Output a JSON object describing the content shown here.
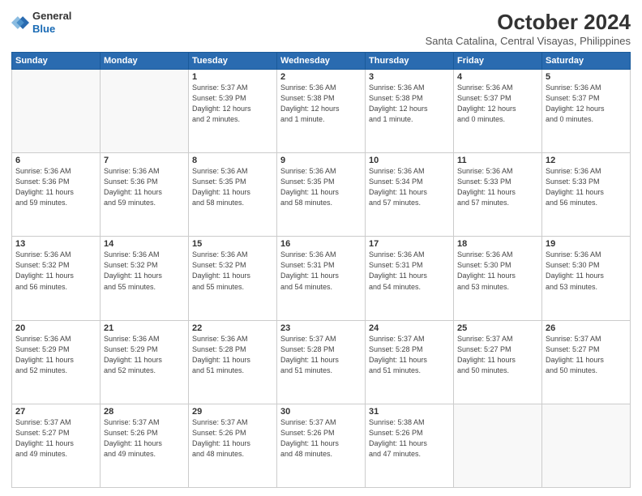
{
  "header": {
    "logo_line1": "General",
    "logo_line2": "Blue",
    "title": "October 2024",
    "subtitle": "Santa Catalina, Central Visayas, Philippines"
  },
  "days_of_week": [
    "Sunday",
    "Monday",
    "Tuesday",
    "Wednesday",
    "Thursday",
    "Friday",
    "Saturday"
  ],
  "weeks": [
    [
      {
        "day": "",
        "info": ""
      },
      {
        "day": "",
        "info": ""
      },
      {
        "day": "1",
        "info": "Sunrise: 5:37 AM\nSunset: 5:39 PM\nDaylight: 12 hours\nand 2 minutes."
      },
      {
        "day": "2",
        "info": "Sunrise: 5:36 AM\nSunset: 5:38 PM\nDaylight: 12 hours\nand 1 minute."
      },
      {
        "day": "3",
        "info": "Sunrise: 5:36 AM\nSunset: 5:38 PM\nDaylight: 12 hours\nand 1 minute."
      },
      {
        "day": "4",
        "info": "Sunrise: 5:36 AM\nSunset: 5:37 PM\nDaylight: 12 hours\nand 0 minutes."
      },
      {
        "day": "5",
        "info": "Sunrise: 5:36 AM\nSunset: 5:37 PM\nDaylight: 12 hours\nand 0 minutes."
      }
    ],
    [
      {
        "day": "6",
        "info": "Sunrise: 5:36 AM\nSunset: 5:36 PM\nDaylight: 11 hours\nand 59 minutes."
      },
      {
        "day": "7",
        "info": "Sunrise: 5:36 AM\nSunset: 5:36 PM\nDaylight: 11 hours\nand 59 minutes."
      },
      {
        "day": "8",
        "info": "Sunrise: 5:36 AM\nSunset: 5:35 PM\nDaylight: 11 hours\nand 58 minutes."
      },
      {
        "day": "9",
        "info": "Sunrise: 5:36 AM\nSunset: 5:35 PM\nDaylight: 11 hours\nand 58 minutes."
      },
      {
        "day": "10",
        "info": "Sunrise: 5:36 AM\nSunset: 5:34 PM\nDaylight: 11 hours\nand 57 minutes."
      },
      {
        "day": "11",
        "info": "Sunrise: 5:36 AM\nSunset: 5:33 PM\nDaylight: 11 hours\nand 57 minutes."
      },
      {
        "day": "12",
        "info": "Sunrise: 5:36 AM\nSunset: 5:33 PM\nDaylight: 11 hours\nand 56 minutes."
      }
    ],
    [
      {
        "day": "13",
        "info": "Sunrise: 5:36 AM\nSunset: 5:32 PM\nDaylight: 11 hours\nand 56 minutes."
      },
      {
        "day": "14",
        "info": "Sunrise: 5:36 AM\nSunset: 5:32 PM\nDaylight: 11 hours\nand 55 minutes."
      },
      {
        "day": "15",
        "info": "Sunrise: 5:36 AM\nSunset: 5:32 PM\nDaylight: 11 hours\nand 55 minutes."
      },
      {
        "day": "16",
        "info": "Sunrise: 5:36 AM\nSunset: 5:31 PM\nDaylight: 11 hours\nand 54 minutes."
      },
      {
        "day": "17",
        "info": "Sunrise: 5:36 AM\nSunset: 5:31 PM\nDaylight: 11 hours\nand 54 minutes."
      },
      {
        "day": "18",
        "info": "Sunrise: 5:36 AM\nSunset: 5:30 PM\nDaylight: 11 hours\nand 53 minutes."
      },
      {
        "day": "19",
        "info": "Sunrise: 5:36 AM\nSunset: 5:30 PM\nDaylight: 11 hours\nand 53 minutes."
      }
    ],
    [
      {
        "day": "20",
        "info": "Sunrise: 5:36 AM\nSunset: 5:29 PM\nDaylight: 11 hours\nand 52 minutes."
      },
      {
        "day": "21",
        "info": "Sunrise: 5:36 AM\nSunset: 5:29 PM\nDaylight: 11 hours\nand 52 minutes."
      },
      {
        "day": "22",
        "info": "Sunrise: 5:36 AM\nSunset: 5:28 PM\nDaylight: 11 hours\nand 51 minutes."
      },
      {
        "day": "23",
        "info": "Sunrise: 5:37 AM\nSunset: 5:28 PM\nDaylight: 11 hours\nand 51 minutes."
      },
      {
        "day": "24",
        "info": "Sunrise: 5:37 AM\nSunset: 5:28 PM\nDaylight: 11 hours\nand 51 minutes."
      },
      {
        "day": "25",
        "info": "Sunrise: 5:37 AM\nSunset: 5:27 PM\nDaylight: 11 hours\nand 50 minutes."
      },
      {
        "day": "26",
        "info": "Sunrise: 5:37 AM\nSunset: 5:27 PM\nDaylight: 11 hours\nand 50 minutes."
      }
    ],
    [
      {
        "day": "27",
        "info": "Sunrise: 5:37 AM\nSunset: 5:27 PM\nDaylight: 11 hours\nand 49 minutes."
      },
      {
        "day": "28",
        "info": "Sunrise: 5:37 AM\nSunset: 5:26 PM\nDaylight: 11 hours\nand 49 minutes."
      },
      {
        "day": "29",
        "info": "Sunrise: 5:37 AM\nSunset: 5:26 PM\nDaylight: 11 hours\nand 48 minutes."
      },
      {
        "day": "30",
        "info": "Sunrise: 5:37 AM\nSunset: 5:26 PM\nDaylight: 11 hours\nand 48 minutes."
      },
      {
        "day": "31",
        "info": "Sunrise: 5:38 AM\nSunset: 5:26 PM\nDaylight: 11 hours\nand 47 minutes."
      },
      {
        "day": "",
        "info": ""
      },
      {
        "day": "",
        "info": ""
      }
    ]
  ]
}
